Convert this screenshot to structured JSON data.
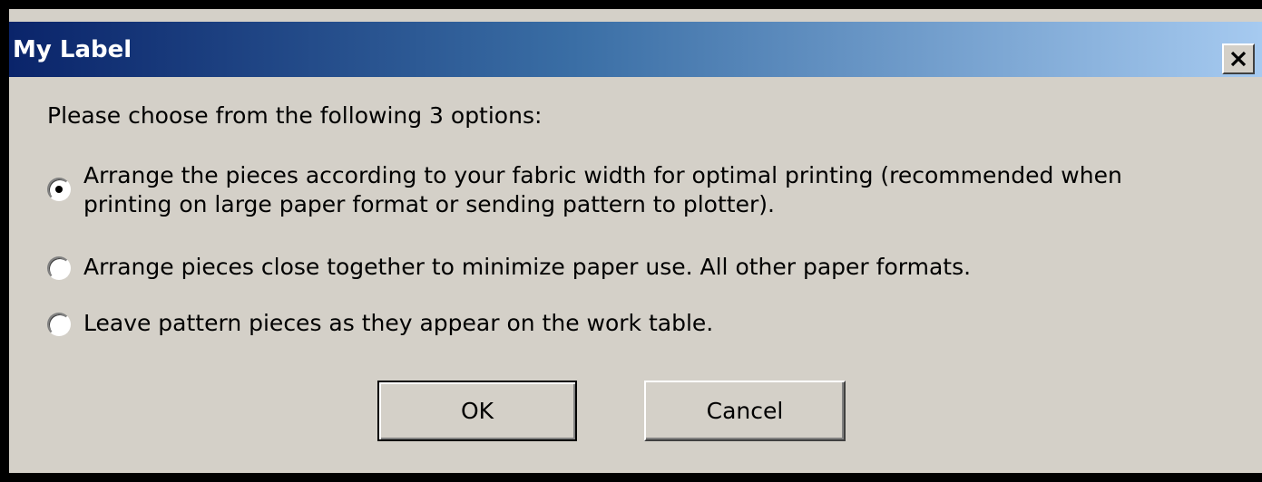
{
  "dialog": {
    "title": "My Label",
    "prompt": "Please choose from the following 3 options:",
    "options": [
      {
        "label": "Arrange the pieces according to your fabric width for optimal printing (recommended when printing on large paper format or sending pattern to plotter).",
        "selected": true
      },
      {
        "label": "Arrange pieces close together to minimize paper use.  All other paper formats.",
        "selected": false
      },
      {
        "label": "Leave pattern pieces as they appear on the work table.",
        "selected": false
      }
    ],
    "ok_label": "OK",
    "cancel_label": "Cancel"
  },
  "colors": {
    "titlebar_start": "#0a246a",
    "titlebar_end": "#a6caf0",
    "dialog_background": "#d4d0c8"
  },
  "icons": {
    "close": "close-icon"
  }
}
